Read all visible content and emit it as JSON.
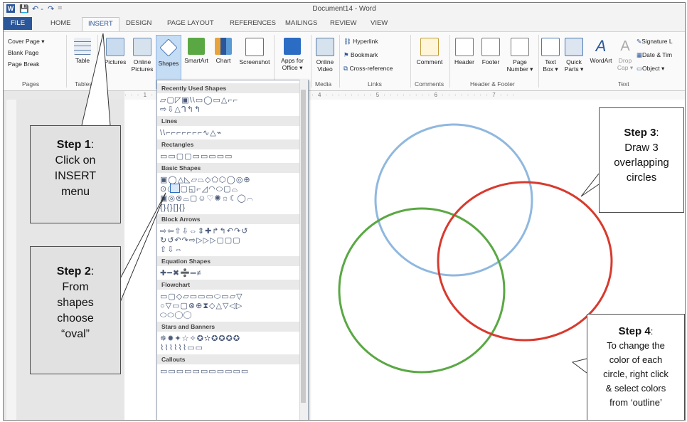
{
  "window": {
    "title": "Document14 - Word",
    "quick_access": [
      "W",
      "💾",
      "↶ -",
      "↷",
      "="
    ]
  },
  "tabs": [
    "FILE",
    "HOME",
    "INSERT",
    "DESIGN",
    "PAGE LAYOUT",
    "REFERENCES",
    "MAILINGS",
    "REVIEW",
    "VIEW"
  ],
  "active_tab": "INSERT",
  "ribbon": {
    "pages": {
      "items": [
        "Cover Page ▾",
        "Blank Page",
        "Page Break"
      ],
      "label": "Pages"
    },
    "tables": {
      "button": "Table",
      "label": "Tables"
    },
    "illustrations": {
      "pictures": "Pictures",
      "online_pictures_1": "Online",
      "online_pictures_2": "Pictures",
      "shapes": "Shapes",
      "smartart": "SmartArt",
      "chart": "Chart",
      "screenshot": "Screenshot"
    },
    "apps": {
      "line1": "Apps for",
      "line2": "Office ▾"
    },
    "media": {
      "line1": "Online",
      "line2": "Video",
      "label": "Media"
    },
    "links": {
      "items": [
        "Hyperlink",
        "Bookmark",
        "Cross-reference"
      ],
      "label": "Links"
    },
    "comments": {
      "button": "Comment",
      "label": "Comments"
    },
    "header_footer": {
      "header": "Header",
      "footer": "Footer",
      "page_line1": "Page",
      "page_line2": "Number ▾",
      "label": "Header & Footer"
    },
    "text": {
      "text_box_1": "Text",
      "text_box_2": "Box ▾",
      "quick_parts_1": "Quick",
      "quick_parts_2": "Parts ▾",
      "wordart": "WordArt",
      "drop_cap_1": "Drop",
      "drop_cap_2": "Cap ▾",
      "signature": "Signature L",
      "date_time": "Date & Tim",
      "object": "Object ▾",
      "label": "Text"
    }
  },
  "shapes_menu": {
    "sections": [
      {
        "title": "Recently Used Shapes",
        "rows": [
          "▱▢◸▣\\\\▭◯▭△⌐⌐",
          "⇨⇩△ᒉ↰↰"
        ]
      },
      {
        "title": "Lines",
        "rows": [
          "\\\\⌐⌐⌐⌐⌐⌐⌐∿△⌁"
        ]
      },
      {
        "title": "Rectangles",
        "rows": [
          "▭▭▢▢▭▭▭▭▭"
        ]
      },
      {
        "title": "Basic Shapes",
        "rows": [
          "▣◯△◺▱⏢◇⬠⬡◯◎⊕",
          "⊙◷◔▢◱⌐◿◠⬭▢⌓",
          "▣◎⊚⌓▢☺♡✺☼☾◯⌒",
          "{}{}[]{}"
        ]
      },
      {
        "title": "Block Arrows",
        "rows": [
          "⇨⇦⇧⇩⇔⇕✚↱↰↶↷↺",
          "↻↺↶↷⇨▷▷▷▢▢▢",
          "⇧⇩⇔"
        ]
      },
      {
        "title": "Equation Shapes",
        "rows": [
          "✚━✖➗═≠"
        ]
      },
      {
        "title": "Flowchart",
        "rows": [
          "▭▢◇▱▭▭▭⬭▭▱▽",
          "○▽▭▢⊗⊕⧗◇△▽◁▷",
          "⬭⬭◯◯"
        ]
      },
      {
        "title": "Stars and Banners",
        "rows": [
          "✵✹✦☆✧✪✫✪✪✪✪",
          "⌇⌇⌇⌇⌇⌇▭▭"
        ]
      },
      {
        "title": "Callouts",
        "rows": [
          "▭▭▭▭▭▭▭▭▭▭▭"
        ]
      }
    ]
  },
  "ruler_text": "· · · 1 · · · · · · · · 2 · · · · · · · · 3 · · · · · · · · 4 · · · · · · · · 5 · · · · · · · · 6 · · · · · · · · 7 · · ·",
  "callouts": {
    "step1": {
      "title": "Step 1",
      "body_1": "Click on",
      "body_2": "INSERT",
      "body_3": "menu"
    },
    "step2": {
      "title": "Step 2",
      "body_1": "From",
      "body_2": "shapes",
      "body_3": "choose",
      "body_4": "“oval”"
    },
    "step3": {
      "title": "Step 3",
      "body_1": "Draw 3",
      "body_2": "overlapping",
      "body_3": "circles"
    },
    "step4": {
      "title": "Step 4",
      "body_1": "To change the",
      "body_2": "color of each",
      "body_3": "circle, right click",
      "body_4": "& select colors",
      "body_5": "from ‘outline’"
    }
  },
  "colors": {
    "circle_blue": "#90b8df",
    "circle_green": "#5aa844",
    "circle_red": "#d83a2e",
    "accent": "#2b579a"
  }
}
